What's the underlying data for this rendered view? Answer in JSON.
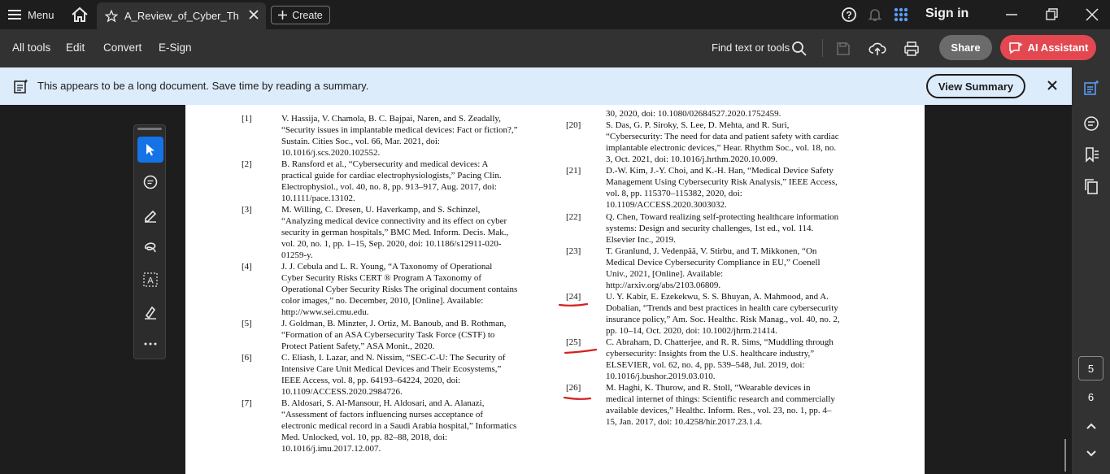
{
  "titlebar": {
    "menu_label": "Menu",
    "tab_title": "A_Review_of_Cyber_Th...",
    "create_label": "Create",
    "signin_label": "Sign in"
  },
  "toolbar": {
    "items": [
      "All tools",
      "Edit",
      "Convert",
      "E-Sign"
    ],
    "find_label": "Find text or tools",
    "share_label": "Share",
    "ai_label": "AI Assistant"
  },
  "banner": {
    "text": "This appears to be a long document. Save time by reading a summary.",
    "button_label": "View Summary"
  },
  "pagination": {
    "current": "5",
    "next": "6"
  },
  "document": {
    "left_refs": [
      {
        "num": "[1]",
        "lines": [
          "V. Hassija, V. Chamola, B. C. Bajpai, Naren, and S. Zeadally,",
          "“Security issues in implantable medical devices: Fact or fiction?,”",
          "Sustain. Cities Soc., vol. 66, Mar. 2021, doi:",
          "10.1016/j.scs.2020.102552."
        ]
      },
      {
        "num": "[2]",
        "lines": [
          "B. Ransford et al., “Cybersecurity and medical devices: A",
          "practical guide for cardiac electrophysiologists,” Pacing Clin.",
          "Electrophysiol., vol. 40, no. 8, pp. 913–917, Aug. 2017, doi:",
          "10.1111/pace.13102."
        ]
      },
      {
        "num": "[3]",
        "lines": [
          "M. Willing, C. Dresen, U. Haverkamp, and S. Schinzel,",
          "“Analyzing medical device connectivity and its effect on cyber",
          "security in german hospitals,” BMC Med. Inform. Decis. Mak.,",
          "vol. 20, no. 1, pp. 1–15, Sep. 2020, doi: 10.1186/s12911-020-",
          "01259-y."
        ]
      },
      {
        "num": "[4]",
        "lines": [
          "J. J. Cebula and L. R. Young, “A Taxonomy of Operational",
          "Cyber Security Risks CERT ® Program A Taxonomy of",
          "Operational Cyber Security Risks The original document contains",
          "color images,” no. December, 2010, [Online]. Available:",
          "http://www.sei.cmu.edu."
        ]
      },
      {
        "num": "[5]",
        "lines": [
          "J. Goldman, B. Minzter, J. Ortiz, M. Banoub, and B. Rothman,",
          "“Formation of an ASA Cybersecurity Task Force (CSTF) to",
          "Protect Patient Safety,” ASA Monit., 2020."
        ]
      },
      {
        "num": "[6]",
        "lines": [
          "C. Eliash, I. Lazar, and N. Nissim, “SEC-C-U: The Security of",
          "Intensive Care Unit Medical Devices and Their Ecosystems,”",
          "IEEE Access, vol. 8, pp. 64193–64224, 2020, doi:",
          "10.1109/ACCESS.2020.2984726."
        ]
      },
      {
        "num": "[7]",
        "lines": [
          "B. Aldosari, S. Al-Mansour, H. Aldosari, and A. Alanazi,",
          "“Assessment of factors influencing nurses acceptance of",
          "electronic medical record in a Saudi Arabia hospital,” Informatics",
          "Med. Unlocked, vol. 10, pp. 82–88, 2018, doi:",
          "10.1016/j.imu.2017.12.007."
        ]
      }
    ],
    "right_top_lines": [
      "30, 2020, doi: 10.1080/02684527.2020.1752459."
    ],
    "right_refs": [
      {
        "num": "[20]",
        "lines": [
          "S. Das, G. P. Siroky, S. Lee, D. Mehta, and R. Suri,",
          "“Cybersecurity: The need for data and patient safety with cardiac",
          "implantable electronic devices,” Hear. Rhythm Soc., vol. 18, no.",
          "3, Oct. 2021, doi: 10.1016/j.hrthm.2020.10.009."
        ]
      },
      {
        "num": "[21]",
        "lines": [
          "D.-W. Kim, J.-Y. Choi, and K.-H. Han, “Medical Device Safety",
          "Management Using Cybersecurity Risk Analysis,” IEEE Access,",
          "vol. 8, pp. 115370–115382, 2020, doi:",
          "10.1109/ACCESS.2020.3003032."
        ]
      },
      {
        "num": "[22]",
        "lines": [
          "Q. Chen, Toward realizing self-protecting healthcare information",
          "systems: Design and security challenges, 1st ed., vol. 114.",
          "Elsevier Inc., 2019."
        ]
      },
      {
        "num": "[23]",
        "lines": [
          "T. Granlund, J. Vedenpää, V. Stirbu, and T. Mikkonen, “On",
          "Medical Device Cybersecurity Compliance in EU,” Coenell",
          "Univ., 2021, [Online]. Available:",
          "http://arxiv.org/abs/2103.06809."
        ]
      },
      {
        "num": "[24]",
        "lines": [
          "U. Y. Kabir, E. Ezekekwu, S. S. Bhuyan, A. Mahmood, and A.",
          "Dobalian, “Trends and best practices in health care cybersecurity",
          "insurance policy,” Am. Soc. Healthc. Risk Manag., vol. 40, no. 2,",
          "pp. 10–14, Oct. 2020, doi: 10.1002/jhrm.21414."
        ]
      },
      {
        "num": "[25]",
        "lines": [
          "C. Abraham, D. Chatterjee, and R. R. Sims, “Muddling through",
          "cybersecurity: Insights from the U.S. healthcare industry,”",
          "ELSEVIER, vol. 62, no. 4, pp. 539–548, Jul. 2019, doi:",
          "10.1016/j.bushor.2019.03.010."
        ]
      },
      {
        "num": "[26]",
        "lines": [
          "M. Haghi, K. Thurow, and R. Stoll, “Wearable devices in",
          "medical internet of things: Scientific research and commercially",
          "available devices,” Healthc. Inform. Res., vol. 23, no. 1, pp. 4–",
          "15, Jan. 2017, doi: 10.4258/hir.2017.23.1.4."
        ]
      }
    ]
  },
  "colors": {
    "annotation_red": "#d42020",
    "ai_button": "#e34850",
    "banner_bg": "#dcecfb",
    "accent_blue": "#1473e6"
  }
}
